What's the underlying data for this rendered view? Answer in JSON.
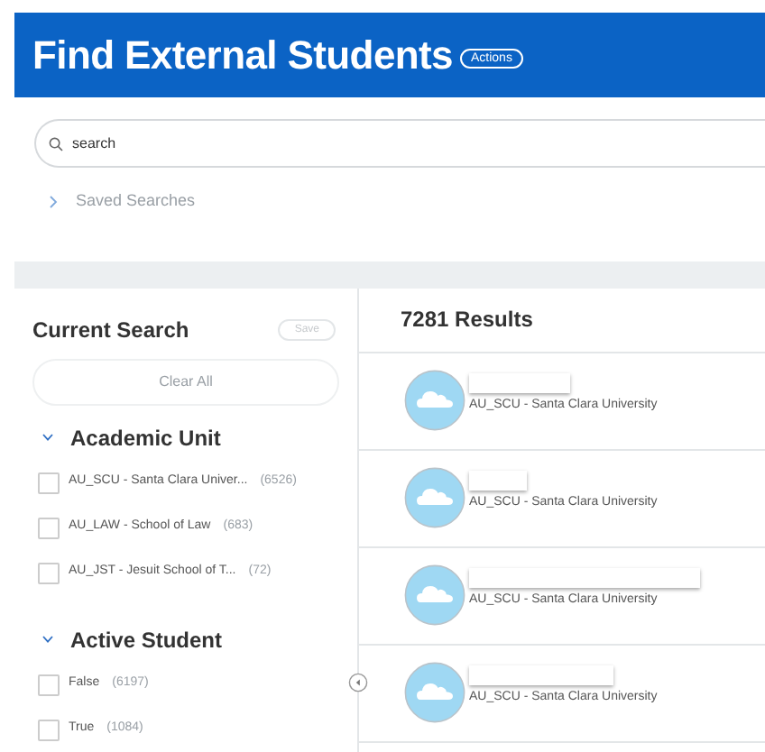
{
  "header": {
    "title": "Find External Students",
    "actions_button": "Actions"
  },
  "search": {
    "placeholder": "search"
  },
  "saved_searches": {
    "label": "Saved Searches",
    "expanded": false
  },
  "current_search": {
    "title": "Current Search",
    "save_button": "Save",
    "clear_button": "Clear All"
  },
  "facets": [
    {
      "title": "Academic Unit",
      "expanded": true,
      "options": [
        {
          "label": "AU_SCU - Santa Clara Univer...",
          "count": "(6526)",
          "checked": false
        },
        {
          "label": "AU_LAW - School of Law",
          "count": "(683)",
          "checked": false
        },
        {
          "label": "AU_JST - Jesuit School of T...",
          "count": "(72)",
          "checked": false
        }
      ]
    },
    {
      "title": "Active Student",
      "expanded": true,
      "options": [
        {
          "label": "False",
          "count": "(6197)",
          "checked": false
        },
        {
          "label": "True",
          "count": "(1084)",
          "checked": false
        }
      ]
    }
  ],
  "results": {
    "count_label": "7281 Results",
    "rows": [
      {
        "subtitle": "AU_SCU - Santa Clara University"
      },
      {
        "subtitle": "AU_SCU - Santa Clara University"
      },
      {
        "subtitle": "AU_SCU - Santa Clara University"
      },
      {
        "subtitle": "AU_SCU - Santa Clara University"
      }
    ]
  }
}
